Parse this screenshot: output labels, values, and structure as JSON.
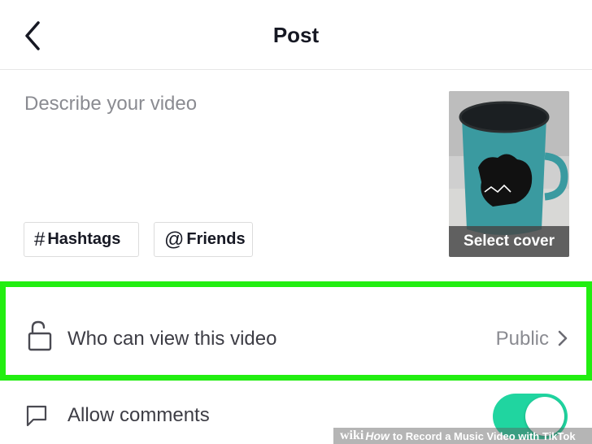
{
  "header": {
    "title": "Post",
    "back_icon": "chevron-left-icon"
  },
  "description": {
    "placeholder": "Describe your video"
  },
  "tags": [
    {
      "symbol": "#",
      "label": "Hashtags"
    },
    {
      "symbol": "@",
      "label": "Friends"
    }
  ],
  "cover": {
    "label": "Select cover"
  },
  "privacy": {
    "icon": "lock-icon",
    "label": "Who can view this video",
    "value": "Public",
    "highlight_color": "#22ee11"
  },
  "comments": {
    "icon": "comment-icon",
    "label": "Allow comments",
    "enabled": true,
    "toggle_color": "#20d5a0"
  },
  "watermark": {
    "wiki": "wiki",
    "how": "How",
    "text": "to Record a Music Video with TikTok"
  }
}
